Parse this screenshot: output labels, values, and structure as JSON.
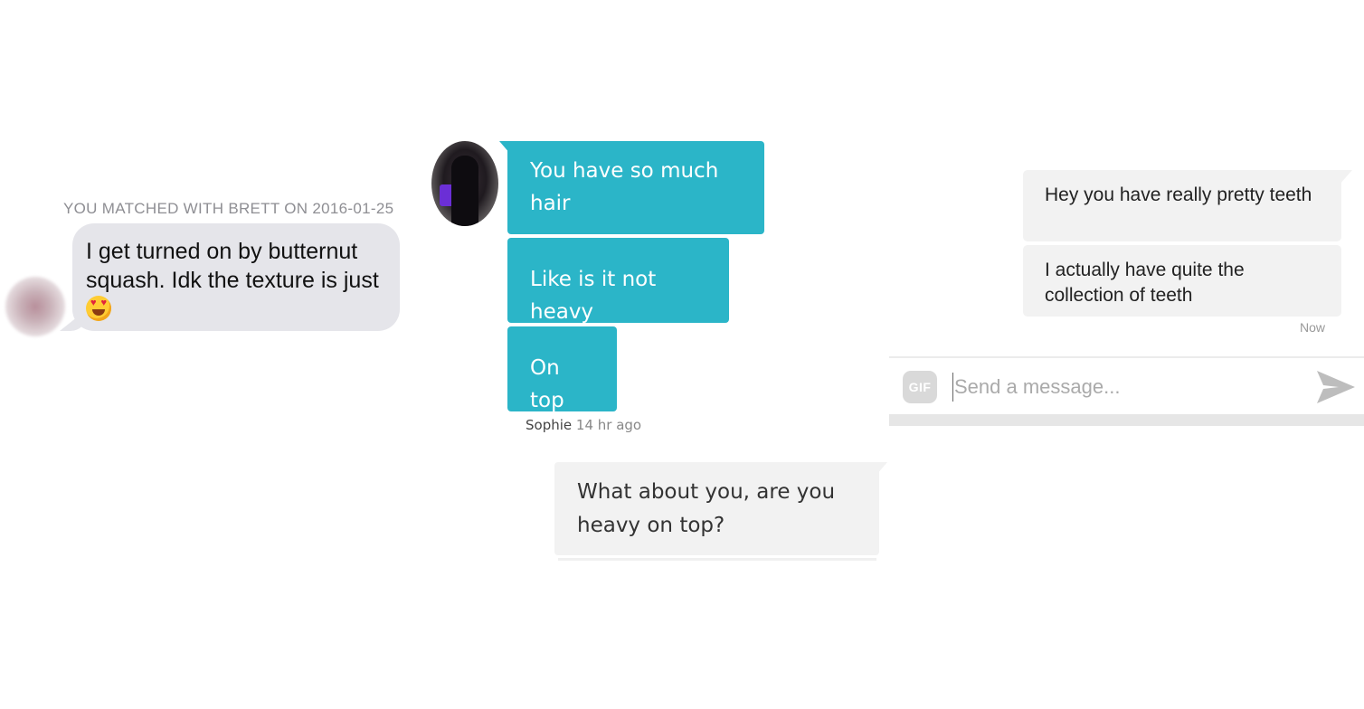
{
  "panel1": {
    "match_header": "YOU MATCHED WITH BRETT ON 2016-01-25",
    "message_text": "I get turned on by butternut squash. Idk the texture is just",
    "emoji": "heart-eyes-emoji"
  },
  "panel2": {
    "messages": [
      "You have so much hair",
      "Like is it not heavy",
      "On top"
    ],
    "sender_name": "Sophie",
    "sender_time": "14 hr ago",
    "reply": "What about you, are you heavy on top?",
    "colors": {
      "sent_bubble": "#2bb5c8",
      "received_bubble": "#f2f2f2"
    }
  },
  "panel3": {
    "messages": [
      "Hey you have really pretty teeth",
      "I actually have quite the collection of teeth"
    ],
    "timestamp": "Now",
    "composer": {
      "gif_label": "GIF",
      "placeholder": "Send a message...",
      "send_icon": "send-arrow-icon"
    }
  }
}
